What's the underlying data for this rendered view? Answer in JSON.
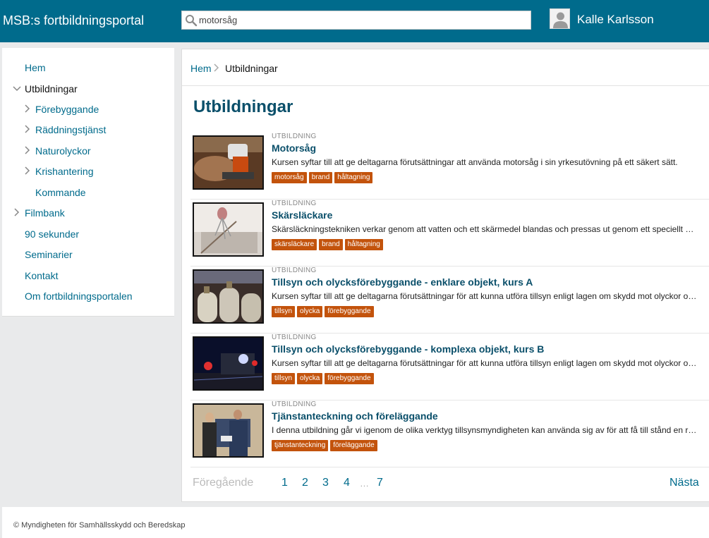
{
  "header": {
    "brand": "MSB:s fortbildningsportal",
    "search_value": "motorsåg",
    "user_name": "Kalle Karlsson"
  },
  "sidebar": {
    "items": [
      {
        "label": "Hem",
        "chevron": "none"
      },
      {
        "label": "Utbildningar",
        "chevron": "down"
      },
      {
        "label": "Förebyggande",
        "chevron": "right"
      },
      {
        "label": "Räddningstjänst",
        "chevron": "right"
      },
      {
        "label": "Naturolyckor",
        "chevron": "right"
      },
      {
        "label": "Krishantering",
        "chevron": "right"
      },
      {
        "label": "Kommande",
        "chevron": "none"
      },
      {
        "label": "Filmbank",
        "chevron": "right"
      },
      {
        "label": "90 sekunder",
        "chevron": "none"
      },
      {
        "label": "Seminarier",
        "chevron": "none"
      },
      {
        "label": "Kontakt",
        "chevron": "none"
      },
      {
        "label": "Om fortbildningsportalen",
        "chevron": "none"
      }
    ]
  },
  "breadcrumb": {
    "home": "Hem",
    "current": "Utbildningar"
  },
  "page_title": "Utbildningar",
  "courses": [
    {
      "kind": "UTBILDNING",
      "title": "Motorsåg",
      "desc": "Kursen syftar till att ge deltagarna förutsättningar att använda motorsåg i sin yrkesutövning på ett säkert sätt.",
      "tags": [
        "motorsåg",
        "brand",
        "håltagning"
      ]
    },
    {
      "kind": "UTBILDNING",
      "title": "Skärsläckare",
      "desc": "Skärsläckningstekniken verkar genom att vatten och ett skärmedel blandas och pressas ut genom ett speciellt munstycke.",
      "tags": [
        "skärsläckare",
        "brand",
        "håltagning"
      ]
    },
    {
      "kind": "UTBILDNING",
      "title": "Tillsyn och olycksförebyggande - enklare objekt, kurs A",
      "desc": "Kursen syftar till att ge deltagarna förutsättningar för att kunna utföra tillsyn enligt lagen om skydd mot olyckor och lagen om brandfarliga varor.",
      "tags": [
        "tillsyn",
        "olycka",
        "förebyggande"
      ]
    },
    {
      "kind": "UTBILDNING",
      "title": "Tillsyn och olycksförebyggande - komplexa objekt, kurs B",
      "desc": "Kursen syftar till att ge deltagarna förutsättningar för att kunna utföra tillsyn enligt lagen om skydd mot olyckor och lagen om brandfarliga varor.",
      "tags": [
        "tillsyn",
        "olycka",
        "förebyggande"
      ]
    },
    {
      "kind": "UTBILDNING",
      "title": "Tjänstanteckning och föreläggande",
      "desc": "I denna utbildning går vi igenom de olika verktyg tillsynsmyndigheten kan använda sig av för att få till stånd en rättelse.",
      "tags": [
        "tjänstanteckning",
        "föreläggande"
      ]
    }
  ],
  "pager": {
    "prev": "Föregående",
    "pages": [
      "1",
      "2",
      "3",
      "4"
    ],
    "dots": "…",
    "last": "7",
    "next": "Nästa"
  },
  "footer": "© Myndigheten för Samhällsskydd och Beredskap",
  "colors": {
    "header_bg": "#006b8c",
    "link": "#006b8c",
    "title": "#0a4f6a",
    "tag_bg": "#c3530c",
    "page_bg": "#e9eaeb"
  }
}
